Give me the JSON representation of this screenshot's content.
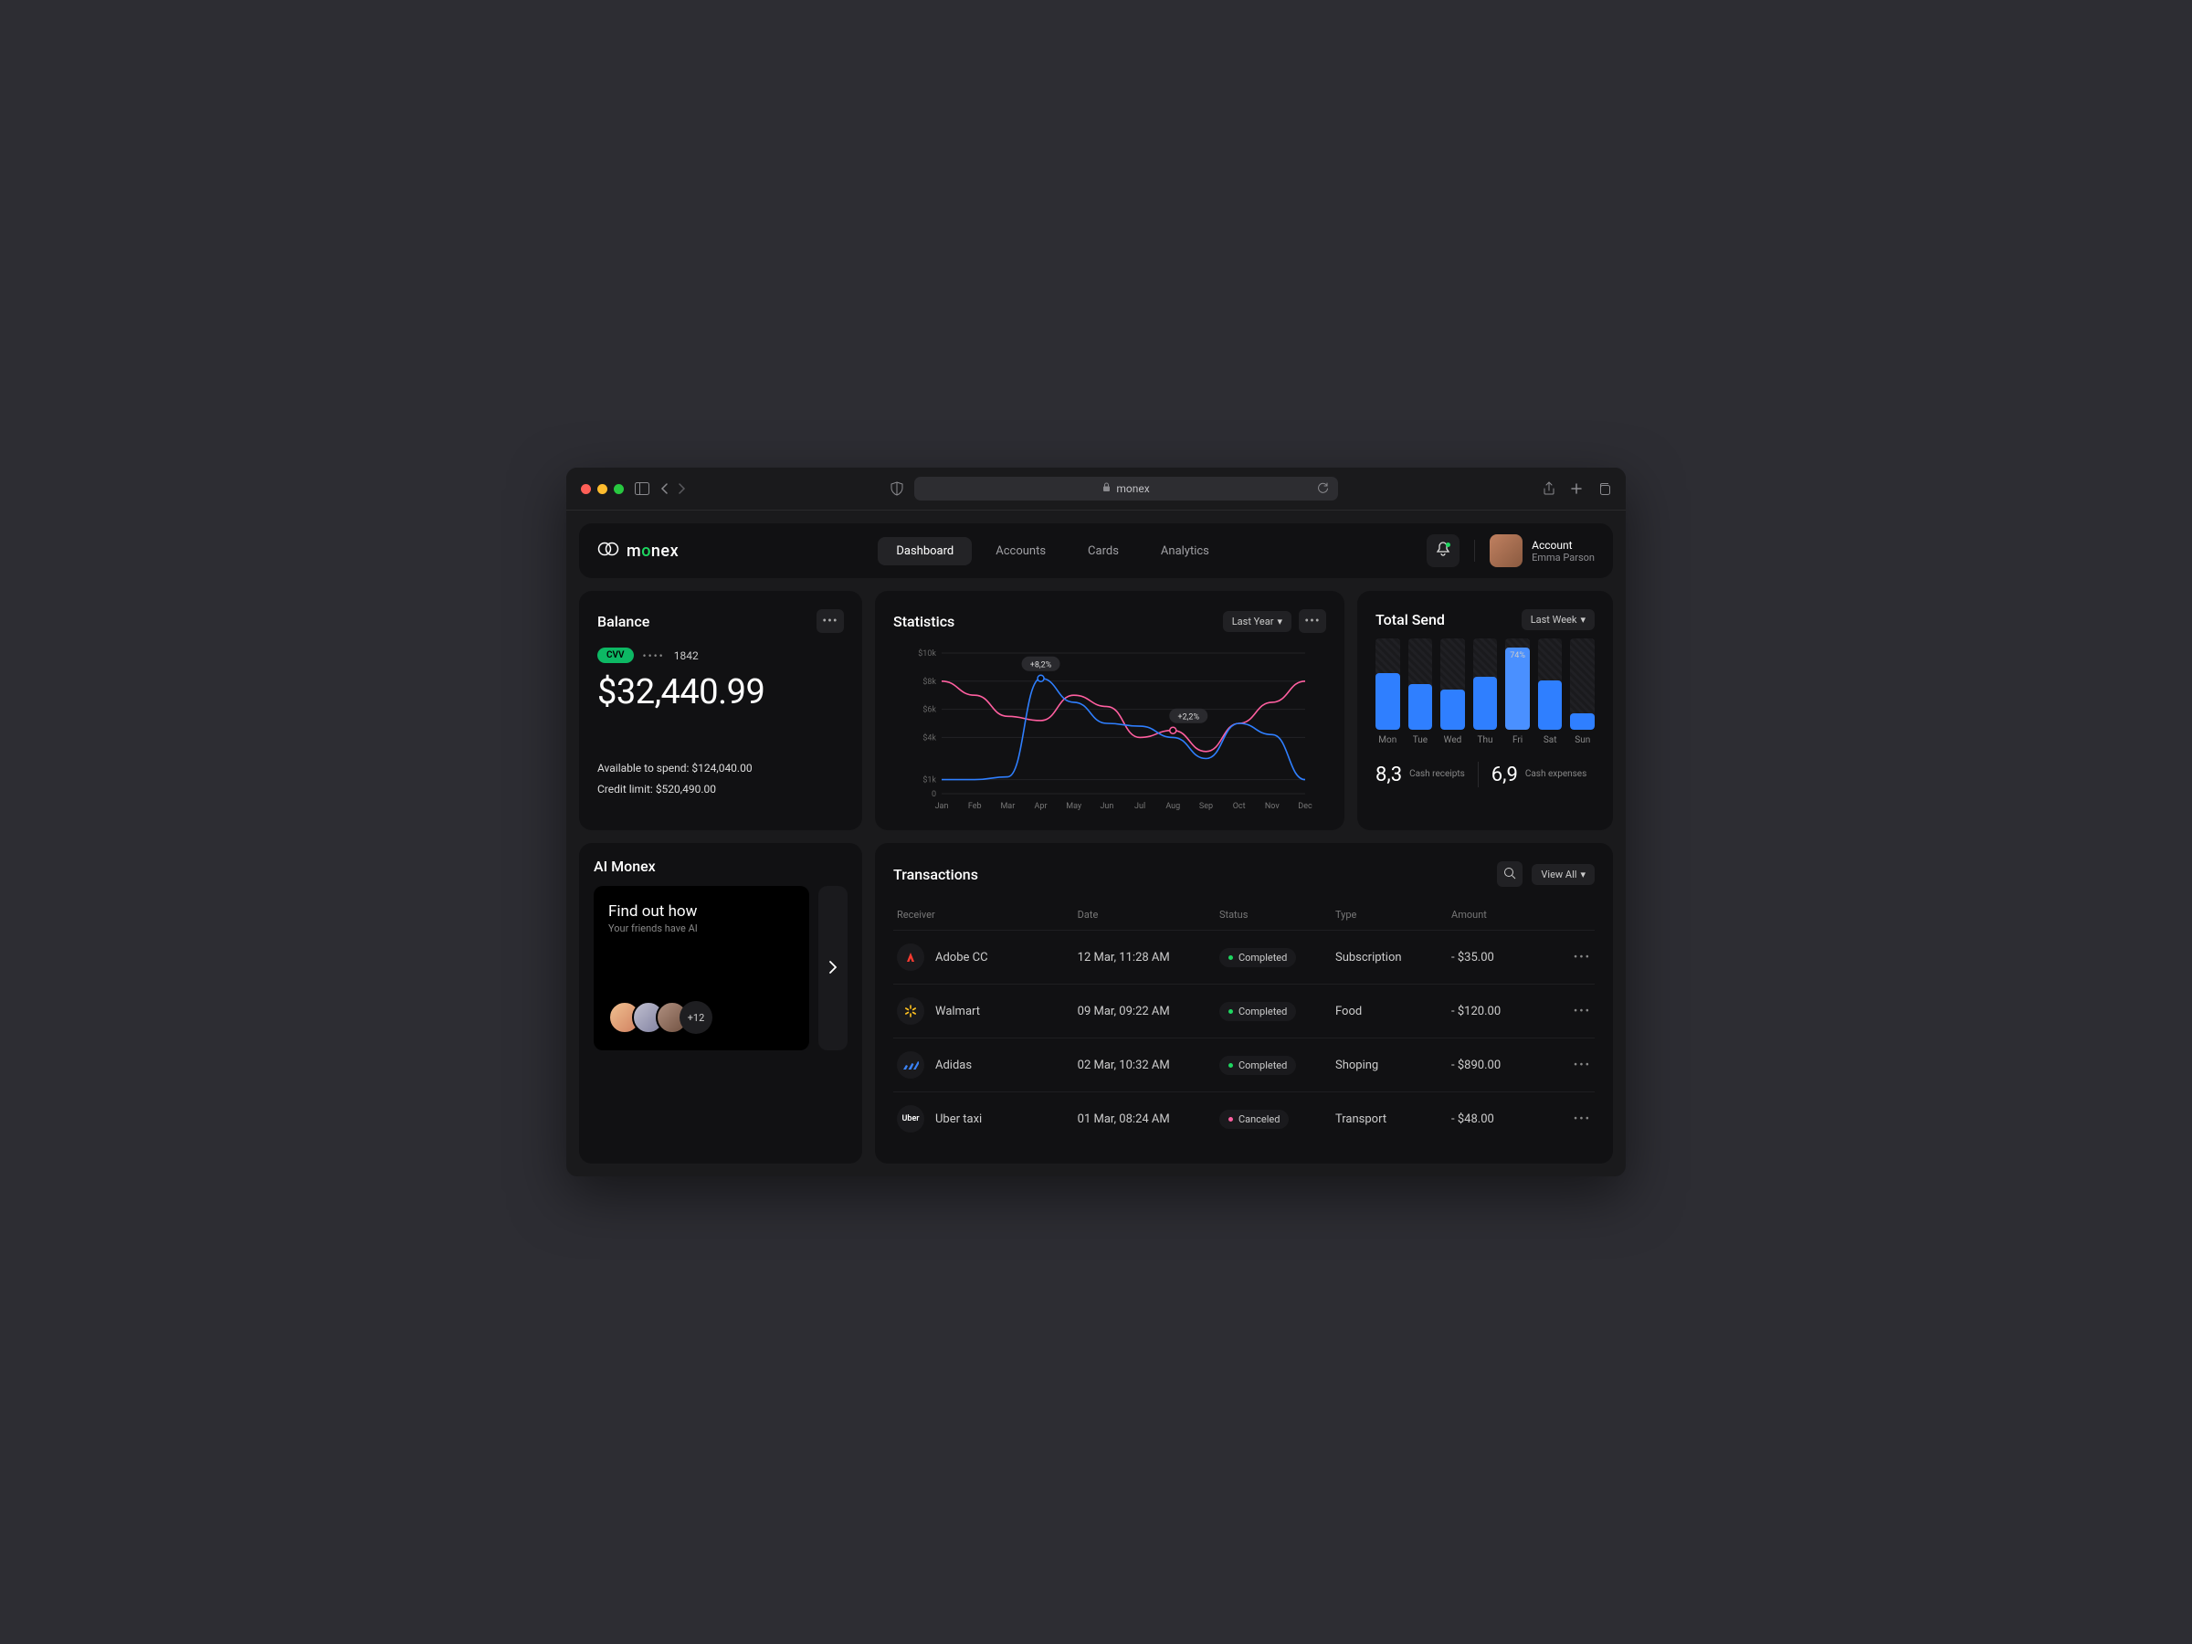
{
  "browser": {
    "url_host": "monex"
  },
  "brand": {
    "name_pre": "m",
    "name_o": "o",
    "name_post": "nex"
  },
  "nav": {
    "items": [
      "Dashboard",
      "Accounts",
      "Cards",
      "Analytics"
    ],
    "active_index": 0
  },
  "account": {
    "label": "Account",
    "name": "Emma Parson"
  },
  "balance": {
    "title": "Balance",
    "cvv_label": "CVV",
    "card_last4": "1842",
    "amount": "$32,440.99",
    "available_label": "Available to spend:",
    "available_value": "$124,040.00",
    "credit_label": "Credit limit:",
    "credit_value": "$520,490.00"
  },
  "statistics": {
    "title": "Statistics",
    "range_label": "Last Year",
    "tooltip1": "+8,2%",
    "tooltip2": "+2,2%",
    "y_ticks": [
      "$10k",
      "$8k",
      "$6k",
      "$4k",
      "$1k",
      "0"
    ],
    "x_ticks": [
      "Jan",
      "Feb",
      "Mar",
      "Apr",
      "May",
      "Jun",
      "Jul",
      "Aug",
      "Sep",
      "Oct",
      "Nov",
      "Dec"
    ]
  },
  "chart_data": {
    "type": "line",
    "x": [
      "Jan",
      "Feb",
      "Mar",
      "Apr",
      "May",
      "Jun",
      "Jul",
      "Aug",
      "Sep",
      "Oct",
      "Nov",
      "Dec"
    ],
    "series": [
      {
        "name": "blue",
        "color": "#2f7fff",
        "values": [
          1.0,
          1.0,
          1.2,
          8.2,
          6.5,
          5.0,
          4.8,
          4.0,
          2.5,
          5.0,
          4.2,
          1.0
        ]
      },
      {
        "name": "pink",
        "color": "#ff5fa0",
        "values": [
          8.0,
          7.0,
          5.5,
          5.2,
          7.0,
          6.2,
          4.0,
          4.5,
          3.0,
          5.0,
          6.5,
          8.0
        ]
      }
    ],
    "ylabel": "$k",
    "ylim": [
      0,
      10
    ],
    "annotations": [
      "+8,2%",
      "+2,2%"
    ]
  },
  "total_send": {
    "title": "Total Send",
    "range_label": "Last Week",
    "highlight_label": "74%",
    "bars": [
      {
        "day": "Mon",
        "pct": 62
      },
      {
        "day": "Tue",
        "pct": 50
      },
      {
        "day": "Wed",
        "pct": 44
      },
      {
        "day": "Thu",
        "pct": 58
      },
      {
        "day": "Fri",
        "pct": 90
      },
      {
        "day": "Sat",
        "pct": 54
      },
      {
        "day": "Sun",
        "pct": 18
      }
    ],
    "receipts_value": "8,3",
    "receipts_label": "Cash\nreceipts",
    "expenses_value": "6,9",
    "expenses_label": "Cash\nexpenses"
  },
  "ai": {
    "title": "AI Monex",
    "slide_title": "Find out how",
    "slide_sub": "Your friends have AI",
    "more_count": "+12"
  },
  "transactions": {
    "title": "Transactions",
    "view_all": "View All",
    "columns": {
      "receiver": "Receiver",
      "date": "Date",
      "status": "Status",
      "type": "Type",
      "amount": "Amount"
    },
    "rows": [
      {
        "icon": "adobe",
        "icon_color": "#ff3b30",
        "name": "Adobe CC",
        "date": "12 Mar, 11:28 AM",
        "status": "Completed",
        "status_kind": "green",
        "type": "Subscription",
        "amount": "- $35.00"
      },
      {
        "icon": "walmart",
        "icon_color": "#ffc220",
        "name": "Walmart",
        "date": "09 Mar, 09:22 AM",
        "status": "Completed",
        "status_kind": "green",
        "type": "Food",
        "amount": "- $120.00"
      },
      {
        "icon": "adidas",
        "icon_color": "#3b82f6",
        "name": "Adidas",
        "date": "02 Mar, 10:32 AM",
        "status": "Completed",
        "status_kind": "green",
        "type": "Shoping",
        "amount": "- $890.00"
      },
      {
        "icon": "uber",
        "icon_color": "#ffffff",
        "name": "Uber taxi",
        "date": "01 Mar, 08:24 AM",
        "status": "Canceled",
        "status_kind": "pink",
        "type": "Transport",
        "amount": "- $48.00"
      }
    ]
  }
}
